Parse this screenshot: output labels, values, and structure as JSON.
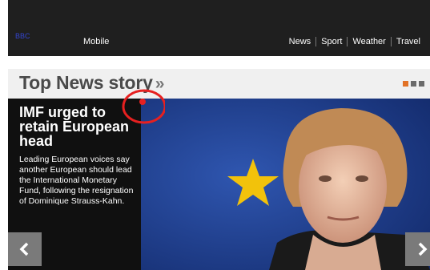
{
  "header": {
    "logo_text": "BBC",
    "mobile_label": "Mobile",
    "nav_items": [
      "News",
      "Sport",
      "Weather",
      "Travel"
    ]
  },
  "story_section": {
    "title": "Top News story",
    "title_suffix": "»",
    "carousel_page": 1,
    "carousel_total": 3,
    "headline": "IMF urged to retain European head",
    "summary": "Leading European voices say another European should lead the International Monetary Fund, following the resignation of Dominique Strauss-Kahn."
  },
  "icons": {
    "prev": "chevron-left-icon",
    "next": "chevron-right-icon",
    "marker": "click-marker-icon"
  },
  "colors": {
    "top_bar": "#1f1f1f",
    "accent_orange": "#e27226",
    "marker_red": "#e62020",
    "eu_blue": "#1e3f8e",
    "eu_star": "#f2c20b"
  }
}
